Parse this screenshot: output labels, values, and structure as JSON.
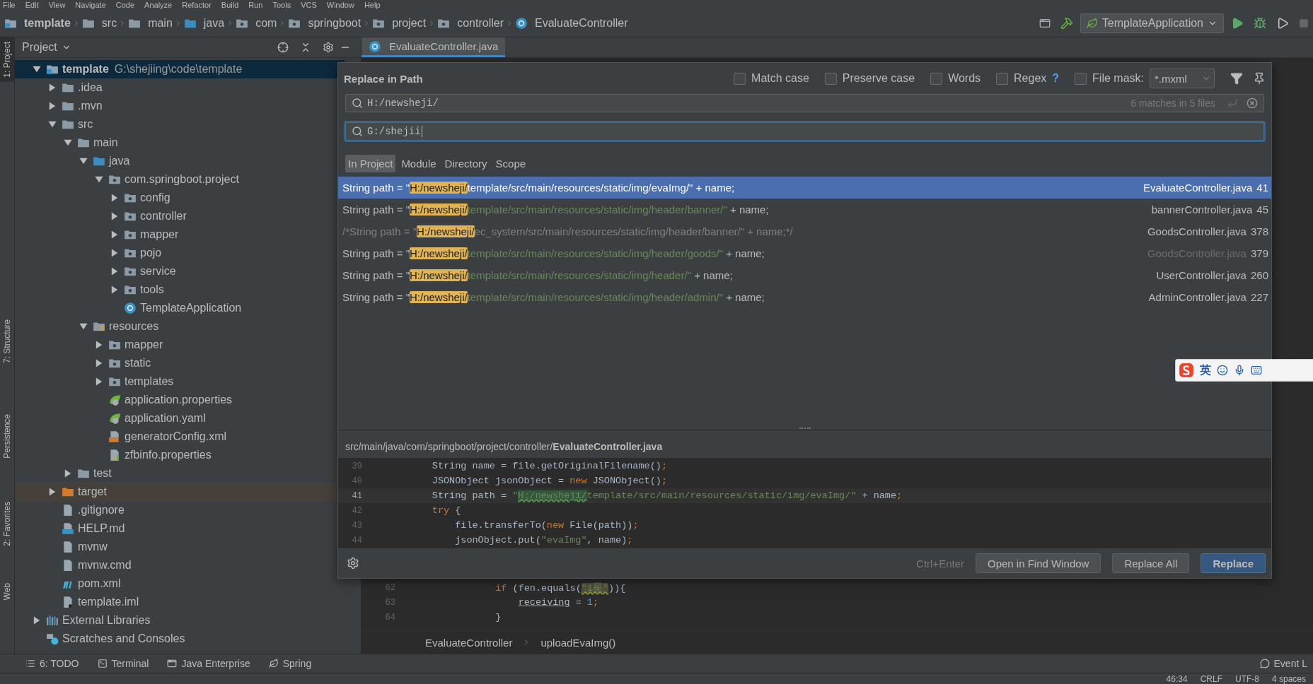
{
  "menu": [
    "File",
    "Edit",
    "View",
    "Navigate",
    "Code",
    "Analyze",
    "Refactor",
    "Build",
    "Run",
    "Tools",
    "VCS",
    "Window",
    "Help"
  ],
  "navbar": {
    "crumbs": [
      {
        "label": "template",
        "kind": "module"
      },
      {
        "label": "src",
        "kind": "folder"
      },
      {
        "label": "main",
        "kind": "folder"
      },
      {
        "label": "java",
        "kind": "source-folder"
      },
      {
        "label": "com",
        "kind": "package"
      },
      {
        "label": "springboot",
        "kind": "package"
      },
      {
        "label": "project",
        "kind": "package"
      },
      {
        "label": "controller",
        "kind": "package"
      },
      {
        "label": "EvaluateController",
        "kind": "class"
      }
    ],
    "run_config": "TemplateApplication"
  },
  "left_stripe": [
    {
      "label": "1: Project",
      "selected": true
    },
    {
      "label": "7: Structure",
      "selected": false
    },
    {
      "label": "Persistence",
      "selected": false
    },
    {
      "label": "2: Favorites",
      "selected": false
    },
    {
      "label": "Web",
      "selected": false
    }
  ],
  "project": {
    "title": "Project",
    "tree": [
      {
        "name": "template",
        "hint": "G:\\shejiing\\code\\template",
        "kind": "module",
        "expanded": true,
        "selected": true,
        "children": [
          {
            "name": ".idea",
            "kind": "folder",
            "expanded": false,
            "selected": false
          },
          {
            "name": ".mvn",
            "kind": "folder",
            "expanded": false,
            "selected": false
          },
          {
            "name": "src",
            "kind": "folder",
            "expanded": true,
            "selected": false,
            "children": [
              {
                "name": "main",
                "kind": "folder",
                "expanded": true,
                "selected": false,
                "children": [
                  {
                    "name": "java",
                    "kind": "source-folder",
                    "expanded": true,
                    "selected": false,
                    "children": [
                      {
                        "name": "com.springboot.project",
                        "kind": "package",
                        "expanded": true,
                        "selected": false,
                        "children": [
                          {
                            "name": "config",
                            "kind": "package",
                            "expanded": false,
                            "selected": false
                          },
                          {
                            "name": "controller",
                            "kind": "package",
                            "expanded": false,
                            "selected": false
                          },
                          {
                            "name": "mapper",
                            "kind": "package",
                            "expanded": false,
                            "selected": false
                          },
                          {
                            "name": "pojo",
                            "kind": "package",
                            "expanded": false,
                            "selected": false
                          },
                          {
                            "name": "service",
                            "kind": "package",
                            "expanded": false,
                            "selected": false
                          },
                          {
                            "name": "tools",
                            "kind": "package",
                            "expanded": false,
                            "selected": false
                          },
                          {
                            "name": "TemplateApplication",
                            "kind": "spring-class",
                            "selected": false
                          }
                        ]
                      }
                    ]
                  },
                  {
                    "name": "resources",
                    "kind": "resources-folder",
                    "expanded": true,
                    "selected": false,
                    "children": [
                      {
                        "name": "mapper",
                        "kind": "package",
                        "expanded": false,
                        "selected": false
                      },
                      {
                        "name": "static",
                        "kind": "package",
                        "expanded": false,
                        "selected": false
                      },
                      {
                        "name": "templates",
                        "kind": "package",
                        "expanded": false,
                        "selected": false
                      },
                      {
                        "name": "application.properties",
                        "kind": "spring-config",
                        "selected": false
                      },
                      {
                        "name": "application.yaml",
                        "kind": "spring-config",
                        "selected": false
                      },
                      {
                        "name": "generatorConfig.xml",
                        "kind": "xml",
                        "selected": false
                      },
                      {
                        "name": "zfbinfo.properties",
                        "kind": "properties",
                        "selected": false
                      }
                    ]
                  }
                ]
              },
              {
                "name": "test",
                "kind": "folder",
                "expanded": false,
                "selected": false
              }
            ]
          },
          {
            "name": "target",
            "kind": "excluded-folder",
            "expanded": false,
            "selected": false
          },
          {
            "name": ".gitignore",
            "kind": "file",
            "selected": false
          },
          {
            "name": "HELP.md",
            "kind": "markdown",
            "selected": false
          },
          {
            "name": "mvnw",
            "kind": "file",
            "selected": false
          },
          {
            "name": "mvnw.cmd",
            "kind": "file",
            "selected": false
          },
          {
            "name": "pom.xml",
            "kind": "maven",
            "selected": false
          },
          {
            "name": "template.iml",
            "kind": "iml",
            "selected": false
          }
        ]
      },
      {
        "name": "External Libraries",
        "kind": "libraries",
        "expanded": false,
        "selected": false
      },
      {
        "name": "Scratches and Consoles",
        "kind": "scratches",
        "selected": false
      }
    ]
  },
  "editor_tab": {
    "label": "EvaluateController.java",
    "selected": true
  },
  "editor_lines": [
    {
      "number": "62",
      "tokens": [
        {
          "text": "            if",
          "kind": "keyword"
        },
        {
          "text": " (fen.equals(",
          "kind": "plain"
        },
        {
          "text": "\"1星\"",
          "kind": "warning"
        },
        {
          "text": ")){",
          "kind": "plain"
        }
      ]
    },
    {
      "number": "63",
      "tokens": [
        {
          "text": "                receiving",
          "kind": "field"
        },
        {
          "text": " = ",
          "kind": "plain"
        },
        {
          "text": "1",
          "kind": "number"
        },
        {
          "text": ";",
          "kind": "keyword"
        }
      ]
    },
    {
      "number": "64",
      "tokens": [
        {
          "text": "            }",
          "kind": "plain"
        }
      ]
    }
  ],
  "editor_breadcrumbs": [
    "EvaluateController",
    "uploadEvaImg()"
  ],
  "dialog": {
    "title": "Replace in Path",
    "options": [
      {
        "label": "Match case",
        "checked": false
      },
      {
        "label": "Preserve case",
        "checked": false
      },
      {
        "label": "Words",
        "checked": false
      },
      {
        "label": "Regex",
        "checked": false,
        "help": "?"
      },
      {
        "label": "File mask:",
        "checked": false
      }
    ],
    "file_mask": "*.mxml",
    "search": {
      "value": "H:/newsheji/",
      "status": "6 matches in 5 files"
    },
    "replace": {
      "value": "G:/shejii",
      "focused": true
    },
    "scopes": [
      {
        "label": "In Project",
        "selected": true
      },
      {
        "label": "Module",
        "selected": false
      },
      {
        "label": "Directory",
        "selected": false
      },
      {
        "label": "Scope",
        "selected": false
      }
    ],
    "results": [
      {
        "selected": true,
        "code": [
          {
            "text": "String path = \"",
            "kind": "plain"
          },
          {
            "text": "H:/newsheji/",
            "kind": "match"
          },
          {
            "text": "template/src/main/resources/static/img/evaImg/\"",
            "kind": "string"
          },
          {
            "text": " + name;",
            "kind": "plain"
          }
        ],
        "file": "EvaluateController.java",
        "line": "41",
        "dimmed": false
      },
      {
        "selected": false,
        "code": [
          {
            "text": "String path = \"",
            "kind": "plain"
          },
          {
            "text": "H:/newsheji/",
            "kind": "match"
          },
          {
            "text": "template/src/main/resources/static/img/header/banner/\"",
            "kind": "string"
          },
          {
            "text": " + name;",
            "kind": "plain"
          }
        ],
        "file": "bannerController.java",
        "line": "45",
        "dimmed": false
      },
      {
        "selected": false,
        "code": [
          {
            "text": "/*String path = \"",
            "kind": "comment"
          },
          {
            "text": "H:/newsheji/",
            "kind": "match"
          },
          {
            "text": "ec_system/src/main/resources/static/img/header/banner/\" + name;*/",
            "kind": "comment"
          }
        ],
        "file": "GoodsController.java",
        "line": "378",
        "dimmed": false
      },
      {
        "selected": false,
        "code": [
          {
            "text": "String path = \"",
            "kind": "plain"
          },
          {
            "text": "H:/newsheji/",
            "kind": "match"
          },
          {
            "text": "template/src/main/resources/static/img/header/goods/\"",
            "kind": "string"
          },
          {
            "text": " + name;",
            "kind": "plain"
          }
        ],
        "file": "GoodsController.java",
        "line": "379",
        "dimmed": true
      },
      {
        "selected": false,
        "code": [
          {
            "text": "String path = \"",
            "kind": "plain"
          },
          {
            "text": "H:/newsheji/",
            "kind": "match"
          },
          {
            "text": "template/src/main/resources/static/img/header/\"",
            "kind": "string"
          },
          {
            "text": " + name;",
            "kind": "plain"
          }
        ],
        "file": "UserController.java",
        "line": "260",
        "dimmed": false
      },
      {
        "selected": false,
        "code": [
          {
            "text": "String path = \"",
            "kind": "plain"
          },
          {
            "text": "H:/newsheji/",
            "kind": "match"
          },
          {
            "text": "template/src/main/resources/static/img/header/admin/\"",
            "kind": "string"
          },
          {
            "text": " + name;",
            "kind": "plain"
          }
        ],
        "file": "AdminController.java",
        "line": "227",
        "dimmed": false
      }
    ],
    "preview_path": "src/main/java/com/springboot/project/controller/**EvaluateController.java**",
    "preview_lines": [
      {
        "number": "39",
        "current": false,
        "tokens": [
          {
            "text": "        String name = file.getOriginalFilename()",
            "kind": "plain"
          },
          {
            "text": ";",
            "kind": "keyword"
          }
        ]
      },
      {
        "number": "40",
        "current": false,
        "tokens": [
          {
            "text": "        JSONObject jsonObject = ",
            "kind": "plain"
          },
          {
            "text": "new",
            "kind": "keyword"
          },
          {
            "text": " JSONObject()",
            "kind": "plain"
          },
          {
            "text": ";",
            "kind": "keyword"
          }
        ]
      },
      {
        "number": "41",
        "current": true,
        "tokens": [
          {
            "text": "        String path = ",
            "kind": "plain"
          },
          {
            "text": "\"",
            "kind": "string"
          },
          {
            "text": "H:/newsheji/",
            "kind": "match"
          },
          {
            "text": "template/src/main/resources/static/img/evaImg/\"",
            "kind": "string"
          },
          {
            "text": " + name",
            "kind": "plain"
          },
          {
            "text": ";",
            "kind": "keyword"
          }
        ]
      },
      {
        "number": "42",
        "current": false,
        "tokens": [
          {
            "text": "        try",
            "kind": "keyword"
          },
          {
            "text": " {",
            "kind": "plain"
          }
        ]
      },
      {
        "number": "43",
        "current": false,
        "tokens": [
          {
            "text": "            file.transferTo(",
            "kind": "plain"
          },
          {
            "text": "new",
            "kind": "keyword"
          },
          {
            "text": " File(path))",
            "kind": "plain"
          },
          {
            "text": ";",
            "kind": "keyword"
          }
        ]
      },
      {
        "number": "44",
        "current": false,
        "tokens": [
          {
            "text": "            jsonObject.put(",
            "kind": "plain"
          },
          {
            "text": "\"evaImg\"",
            "kind": "string"
          },
          {
            "text": ", name)",
            "kind": "plain"
          },
          {
            "text": ";",
            "kind": "keyword"
          }
        ]
      }
    ],
    "shortcut": "Ctrl+Enter",
    "buttons": [
      {
        "label": "Open in Find Window",
        "primary": false
      },
      {
        "label": "Replace All",
        "primary": false
      },
      {
        "label": "Replace",
        "primary": true
      }
    ]
  },
  "ime_bar": {
    "mode": "英"
  },
  "tool_tabs": [
    {
      "label": "6: TODO",
      "kind": "todo"
    },
    {
      "label": "Terminal",
      "kind": "terminal"
    },
    {
      "label": "Java Enterprise",
      "kind": "enterprise"
    },
    {
      "label": "Spring",
      "kind": "spring"
    }
  ],
  "event_log": "Event L",
  "status": [
    "46:34",
    "CRLF",
    "UTF-8",
    "4 spaces"
  ]
}
